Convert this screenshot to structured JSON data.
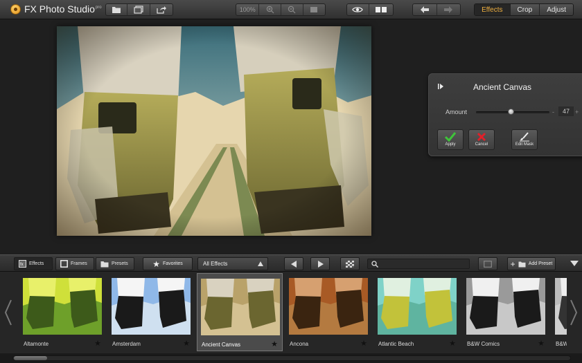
{
  "app": {
    "title": "FX Photo Studio",
    "title_badge": "pro"
  },
  "toolbar": {
    "zoom_value": "100%",
    "tabs": [
      {
        "label": "Effects",
        "active": true
      },
      {
        "label": "Crop",
        "active": false
      },
      {
        "label": "Adjust",
        "active": false
      }
    ],
    "icons": [
      "open-icon",
      "gallery-icon",
      "share-icon",
      "zoom-in-icon",
      "zoom-out-icon",
      "fit-icon",
      "eye-icon",
      "compare-icon",
      "undo-icon",
      "redo-icon"
    ]
  },
  "effect_panel": {
    "title": "Ancient Canvas",
    "amount_label": "Amount",
    "amount_value": "47",
    "amount_min_symbol": "-",
    "amount_max_symbol": "+",
    "apply_label": "Apply",
    "cancel_label": "Cancel",
    "edit_mask_label": "Edit Mask"
  },
  "bottom_bar": {
    "tabs": [
      {
        "label": "Effects",
        "active": true
      },
      {
        "label": "Frames",
        "active": false
      },
      {
        "label": "Presets",
        "active": false
      }
    ],
    "favorites_label": "Favorites",
    "filter_selected": "All Effects",
    "search_placeholder": "",
    "add_preset_label": "Add Preset"
  },
  "effects": [
    {
      "name": "Altamonte",
      "selected": false
    },
    {
      "name": "Amsterdam",
      "selected": false
    },
    {
      "name": "Ancient Canvas",
      "selected": true
    },
    {
      "name": "Ancona",
      "selected": false
    },
    {
      "name": "Atlantic Beach",
      "selected": false
    },
    {
      "name": "B&W Comics",
      "selected": false
    },
    {
      "name": "B&W",
      "selected": false
    }
  ],
  "colors": {
    "accent_active_tab": "#f0b040",
    "apply_green": "#3fc43a",
    "cancel_red": "#e0202a"
  },
  "amount_fraction": 0.47
}
